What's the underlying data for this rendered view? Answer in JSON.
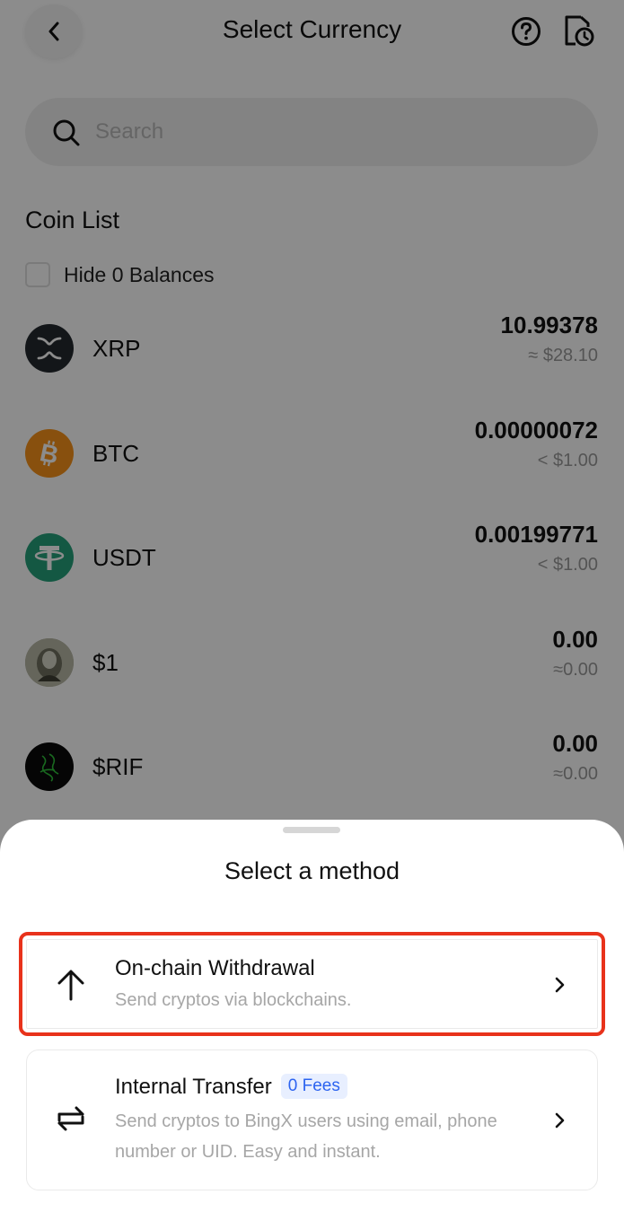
{
  "header": {
    "title": "Select Currency",
    "back_icon": "chevron-left-icon",
    "help_icon": "question-circle-icon",
    "history_icon": "history-icon"
  },
  "search": {
    "placeholder": "Search",
    "value": ""
  },
  "coin_list": {
    "title": "Coin List",
    "hide_zero_label": "Hide 0 Balances",
    "hide_zero_checked": false,
    "coins": [
      {
        "name": "XRP",
        "amount": "10.99378",
        "usd": "≈ $28.10",
        "icon": "xrp-icon",
        "color": "#23292f"
      },
      {
        "name": "BTC",
        "amount": "0.00000072",
        "usd": "< $1.00",
        "icon": "btc-icon",
        "color": "#f7931a"
      },
      {
        "name": "USDT",
        "amount": "0.00199771",
        "usd": "< $1.00",
        "icon": "usdt-icon",
        "color": "#26a17b"
      },
      {
        "name": "$1",
        "amount": "0.00",
        "usd": "≈0.00",
        "icon": "dollar-bill-icon",
        "color": "#9c9e8c"
      },
      {
        "name": "$RIF",
        "amount": "0.00",
        "usd": "≈0.00",
        "icon": "rif-icon",
        "color": "#0a0a0a"
      }
    ]
  },
  "sheet": {
    "title": "Select a method",
    "methods": [
      {
        "title": "On-chain Withdrawal",
        "desc": "Send cryptos via blockchains.",
        "icon": "arrow-up-icon",
        "highlighted": true
      },
      {
        "title": "Internal Transfer",
        "badge": "0 Fees",
        "desc_line1": "Send cryptos to BingX users using email, phone",
        "desc_line2": "number or UID. Easy and instant.",
        "icon": "transfer-arrows-icon",
        "highlighted": false
      }
    ]
  },
  "colors": {
    "highlight": "#e8321b",
    "badge_text": "#2d64f0",
    "badge_bg": "#e8efff",
    "overlay": "rgba(0,0,0,0.45)"
  }
}
